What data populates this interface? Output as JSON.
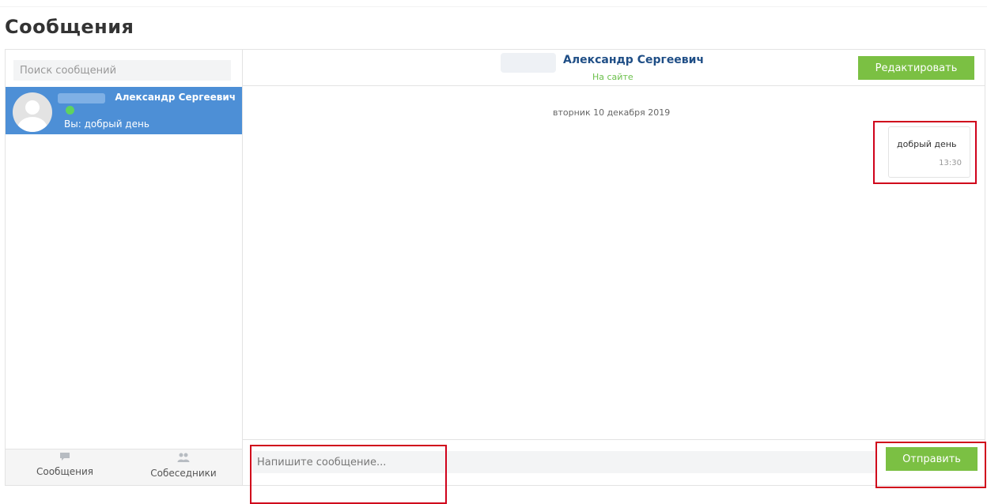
{
  "page": {
    "title": "Сообщения"
  },
  "sidebar": {
    "search_placeholder": "Поиск сообщений",
    "contacts": [
      {
        "name": "Александр Сергеевич",
        "preview": "Вы: добрый день",
        "online": true
      }
    ],
    "footer": [
      {
        "label": "Сообщения",
        "icon": "speech-bubble-icon"
      },
      {
        "label": "Собеседники",
        "icon": "people-icon"
      }
    ]
  },
  "chat": {
    "contact_name": "Александр Сергеевич",
    "status": "На сайте",
    "edit_label": "Редактировать",
    "date_separator": "вторник 10 декабря 2019",
    "messages": [
      {
        "text": "добрый день",
        "time": "13:30",
        "outgoing": true
      }
    ],
    "input_placeholder": "Напишите сообщение...",
    "send_label": "Отправить"
  },
  "colors": {
    "accent_green": "#7bc043",
    "selected_blue": "#4d8fd6",
    "online_green": "#5fd35f",
    "highlight_red": "#d0021b"
  }
}
